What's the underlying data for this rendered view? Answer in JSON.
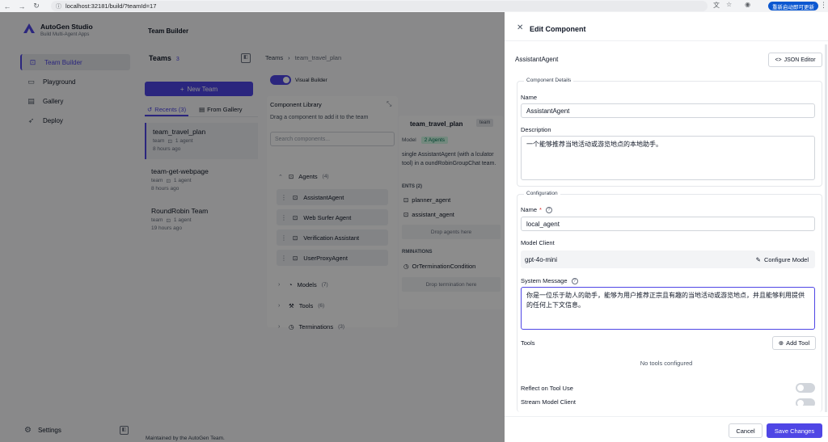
{
  "browser": {
    "url": "localhost:32181/build/?teamId=17",
    "restart_label": "重新启动即可更新"
  },
  "app": {
    "name": "AutoGen Studio",
    "tagline": "Build Multi-Agent Apps",
    "page_title": "Team Builder",
    "footer": "Maintained by the AutoGen Team.",
    "settings_label": "Settings"
  },
  "nav": [
    {
      "label": "Team Builder",
      "icon": "robot-icon",
      "active": true
    },
    {
      "label": "Playground",
      "icon": "chat-icon",
      "active": false
    },
    {
      "label": "Gallery",
      "icon": "gallery-icon",
      "active": false
    },
    {
      "label": "Deploy",
      "icon": "rocket-icon",
      "active": false
    }
  ],
  "teams_panel": {
    "title": "Teams",
    "count": "3",
    "new_team_label": "New Team",
    "tab_recents": "Recents (3)",
    "tab_gallery": "From Gallery",
    "teams": [
      {
        "name": "team_travel_plan",
        "type": "team",
        "agents": "1 agent",
        "time": "8 hours ago"
      },
      {
        "name": "team-get-webpage",
        "type": "team",
        "agents": "1 agent",
        "time": "8 hours ago"
      },
      {
        "name": "RoundRobin Team",
        "type": "team",
        "agents": "1 agent",
        "time": "19 hours ago"
      }
    ]
  },
  "breadcrumb": {
    "root": "Teams",
    "current": "team_travel_plan"
  },
  "visual_builder_label": "Visual Builder",
  "library": {
    "title": "Component Library",
    "subtitle": "Drag a component to add it to the team",
    "search_placeholder": "Search components...",
    "agents_label": "Agents",
    "agents_count": "(4)",
    "agents": [
      "AssistantAgent",
      "Web Surfer Agent",
      "Verification Assistant",
      "UserProxyAgent"
    ],
    "models_label": "Models",
    "models_count": "(7)",
    "tools_label": "Tools",
    "tools_count": "(6)",
    "terminations_label": "Terminations",
    "terminations_count": "(3)"
  },
  "canvas_card": {
    "title": "team_travel_plan",
    "badge": "team",
    "model_label": "Model",
    "agents_badge": "2 Agents",
    "description": "single AssistantAgent (with a lculator tool) in a oundRobinGroupChat team.",
    "agents_section": "ENTS (2)",
    "agent_items": [
      "planner_agent",
      "assistant_agent"
    ],
    "drop_agents": "Drop agents here",
    "terminations_section": "RMINATIONS",
    "termination_item": "OrTerminationCondition",
    "drop_termination": "Drop termination here"
  },
  "drawer": {
    "title": "Edit Component",
    "component_type": "AssistantAgent",
    "json_editor_label": "JSON Editor",
    "details_legend": "Component Details",
    "name_label": "Name",
    "name_value": "AssistantAgent",
    "description_label": "Description",
    "description_value": "一个能够推荐当地活动或游览地点的本地助手。",
    "config_legend": "Configuration",
    "config_name_label": "Name",
    "config_name_required": "*",
    "config_name_value": "local_agent",
    "model_client_label": "Model Client",
    "model_client_value": "gpt-4o-mini",
    "configure_model_label": "Configure Model",
    "system_message_label": "System Message",
    "system_message_value": "你是一位乐于助人的助手，能够为用户推荐正宗且有趣的当地活动或游览地点，并且能够利用提供的任何上下文信息。",
    "tools_label": "Tools",
    "add_tool_label": "Add Tool",
    "no_tools": "No tools configured",
    "reflect_label": "Reflect on Tool Use",
    "reflect_on": false,
    "stream_label": "Stream Model Client",
    "stream_on": false,
    "cancel_label": "Cancel",
    "save_label": "Save Changes"
  },
  "colors": {
    "accent": "#4f46e5",
    "success_bg": "#d1fae5",
    "overlay": "rgba(0,0,0,0.45)"
  }
}
